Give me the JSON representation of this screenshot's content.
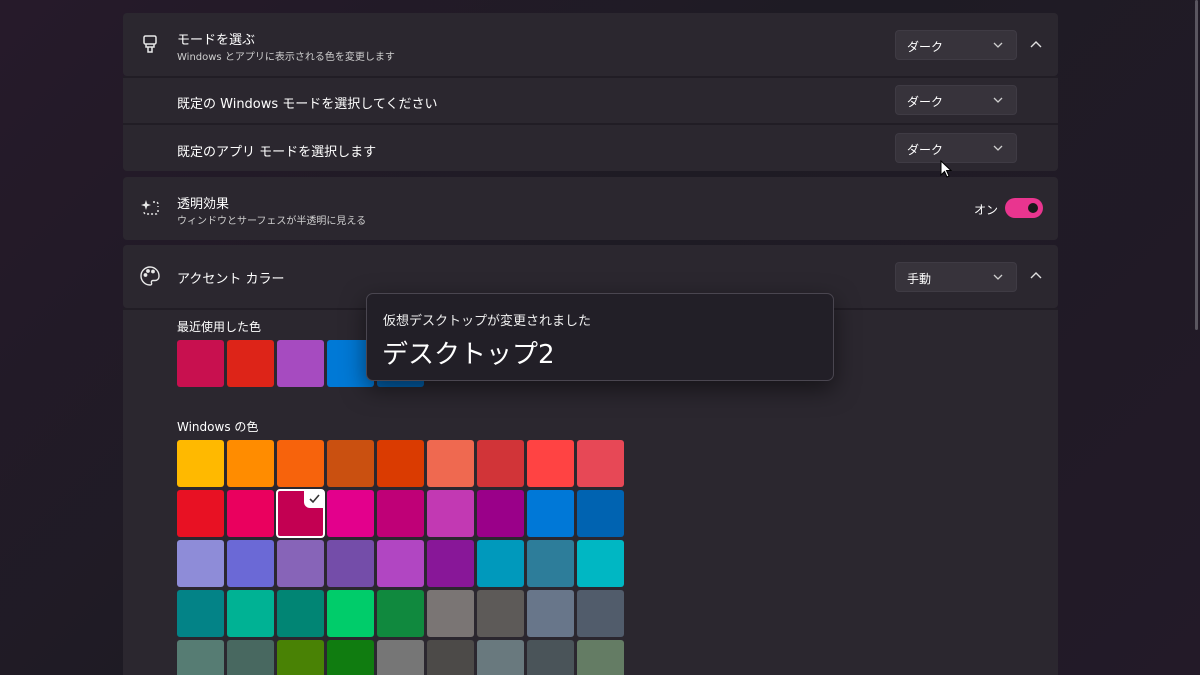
{
  "mode": {
    "title": "モードを選ぶ",
    "subtitle": "Windows とアプリに表示される色を変更します",
    "value": "ダーク",
    "icon": "brush-icon"
  },
  "windows_mode": {
    "label": "既定の Windows モードを選択してください",
    "value": "ダーク"
  },
  "app_mode": {
    "label": "既定のアプリ モードを選択します",
    "value": "ダーク"
  },
  "transparency": {
    "title": "透明効果",
    "subtitle": "ウィンドウとサーフェスが半透明に見える",
    "state_label": "オン",
    "on": true,
    "icon": "transparency-sparkle-icon"
  },
  "accent": {
    "title": "アクセント カラー",
    "value": "手動",
    "icon": "palette-icon",
    "recent_label": "最近使用した色",
    "recent_colors": [
      "#c8104f",
      "#dd2418",
      "#a64bc0",
      "#0079d6",
      "#0063b1"
    ],
    "windows_label": "Windows の色",
    "windows_colors": [
      [
        "#ffb900",
        "#ff8c00",
        "#f7630c",
        "#ca5010",
        "#da3b01",
        "#ef6950",
        "#d13438",
        "#ff4343",
        "#e74856"
      ],
      [
        "#e81123",
        "#ea005e",
        "#c30052",
        "#e3008c",
        "#bf0077",
        "#c239b3",
        "#9a0089",
        "#0078d7",
        "#0063b1"
      ],
      [
        "#8e8cd8",
        "#6b69d6",
        "#8764b8",
        "#744da9",
        "#b146c2",
        "#881798",
        "#0099bc",
        "#2d7d9a",
        "#00b7c3"
      ],
      [
        "#038387",
        "#00b294",
        "#018574",
        "#00cc6a",
        "#10893e",
        "#7a7574",
        "#5d5a58",
        "#68768a",
        "#515c6b"
      ],
      [
        "#567c73",
        "#486860",
        "#498205",
        "#107c10",
        "#767676",
        "#4c4a48",
        "#69797e",
        "#4a5459",
        "#647c64"
      ]
    ],
    "selected": {
      "row": 1,
      "col": 2
    }
  },
  "toast": {
    "message": "仮想デスクトップが変更されました",
    "desktop_name": "デスクトップ2"
  },
  "colors": {
    "accent": "#e9358f",
    "panel": "#2b272f"
  }
}
